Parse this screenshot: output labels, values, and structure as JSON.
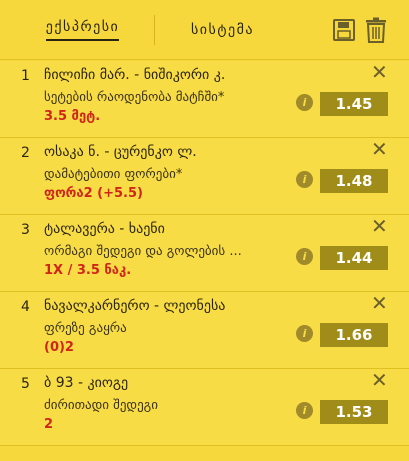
{
  "header": {
    "tabs": [
      {
        "label": "ექსპრესი"
      },
      {
        "label": "სისტემა"
      }
    ],
    "icons": {
      "save": "save-icon",
      "trash": "trash-icon"
    }
  },
  "close_symbol": "✕",
  "info_symbol": "i",
  "bets": [
    {
      "index": "1",
      "match": "ჩილიჩი მარ. - ნიშიკორი კ.",
      "market": "სეტების რაოდენობა მატჩში*",
      "outcome": "3.5 მეტ.",
      "odds": "1.45"
    },
    {
      "index": "2",
      "match": "ოსაკა ნ. - ცურენკო ლ.",
      "market": "დამატებითი ფორები*",
      "outcome": "ფორა2 (+5.5)",
      "odds": "1.48"
    },
    {
      "index": "3",
      "match": "ტალავერა - ხაენი",
      "market": "ორმაგი შედეგი და გოლების ...",
      "outcome": "1X / 3.5 ნაკ.",
      "odds": "1.44"
    },
    {
      "index": "4",
      "match": "ნავალკარნერო - ლეონესა",
      "market": "ფრეზე გაყრა",
      "outcome": "(0)2",
      "odds": "1.66"
    },
    {
      "index": "5",
      "match": "ბ 93 - კიოგე",
      "market": "ძირითადი შედეგი",
      "outcome": "2",
      "odds": "1.53"
    }
  ],
  "colors": {
    "background": "#f6d83c",
    "odds_bg": "#a08c18",
    "outcome": "#d0261a"
  }
}
